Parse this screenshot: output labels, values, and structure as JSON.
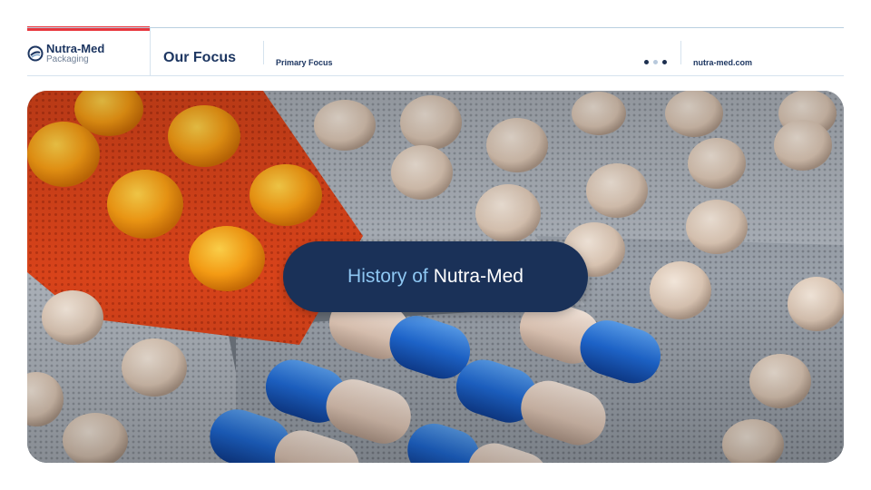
{
  "header": {
    "logo": {
      "name": "Nutra-Med",
      "sub": "Packaging"
    },
    "section_title": "Our Focus",
    "subsection": "Primary Focus",
    "website": "nutra-med.com"
  },
  "pager": {
    "count": 3,
    "active_index": 1
  },
  "hero": {
    "title_part1": "History of",
    "title_part2": "Nutra-Med"
  },
  "colors": {
    "brand_navy": "#1d3661",
    "accent_red": "#e8363d",
    "title_pill": "#1a3158",
    "title_light": "#8ec7f2"
  },
  "icons": [
    "logo-mark-icon"
  ]
}
